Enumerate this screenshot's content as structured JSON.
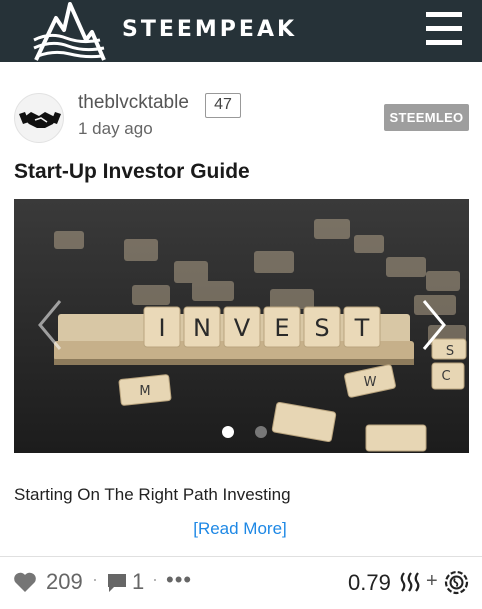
{
  "header": {
    "brand": "STEEMPEAK",
    "logo_icon": "mountain-logo-icon",
    "menu_icon": "hamburger-menu-icon",
    "background": "#263238"
  },
  "post": {
    "author": "theblvcktable",
    "reputation": "47",
    "time": "1 day ago",
    "tag": "STEEMLEO",
    "title": "Start-Up Investor Guide",
    "image": {
      "description_icon": "scrabble-tiles-invest-image",
      "tiles": [
        "I",
        "N",
        "V",
        "E",
        "S",
        "T"
      ],
      "active_slide": 1,
      "slide_count": 2
    },
    "excerpt": "Starting On The Right Path Investing",
    "read_more": "[Read More]"
  },
  "footer": {
    "votes": "209",
    "comments": "1",
    "more": "•••",
    "payout": "0.79",
    "plus": "+"
  },
  "colors": {
    "link": "#1e88e5",
    "tag_bg": "#9e9e9e"
  }
}
